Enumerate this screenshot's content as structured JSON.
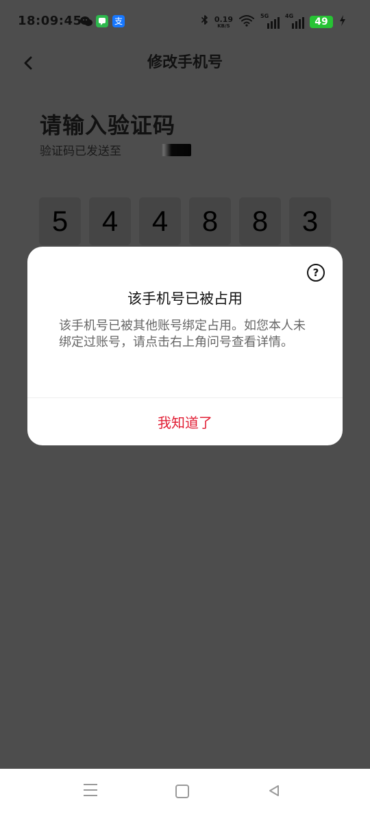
{
  "status_bar": {
    "time": "18:09:45",
    "speed_value": "0.19",
    "speed_unit": "KB/S",
    "net_1": "5G",
    "net_2": "4G",
    "battery": "49"
  },
  "header": {
    "title": "修改手机号"
  },
  "page": {
    "heading": "请输入验证码",
    "subtitle": "验证码已发送至"
  },
  "code_digits": [
    "5",
    "4",
    "4",
    "8",
    "8",
    "3"
  ],
  "dialog": {
    "help_label": "?",
    "title": "该手机号已被占用",
    "body": "该手机号已被其他账号绑定占用。如您本人未绑定过账号，请点击右上角问号查看详情。",
    "confirm_label": "我知道了"
  },
  "colors": {
    "accent": "#e11d33",
    "battery": "#27c334",
    "overlay_bg": "#4d4d4d"
  },
  "icons": {
    "back": "chevron-left-icon",
    "help": "question-circle-icon",
    "wifi": "wifi-icon",
    "bluetooth": "bluetooth-icon",
    "charging": "lightning-icon",
    "wechat": "wechat-icon",
    "message": "message-icon",
    "alipay": "alipay-icon",
    "nav_menu": "menu-icon",
    "nav_home": "home-square-icon",
    "nav_back": "back-triangle-icon"
  }
}
